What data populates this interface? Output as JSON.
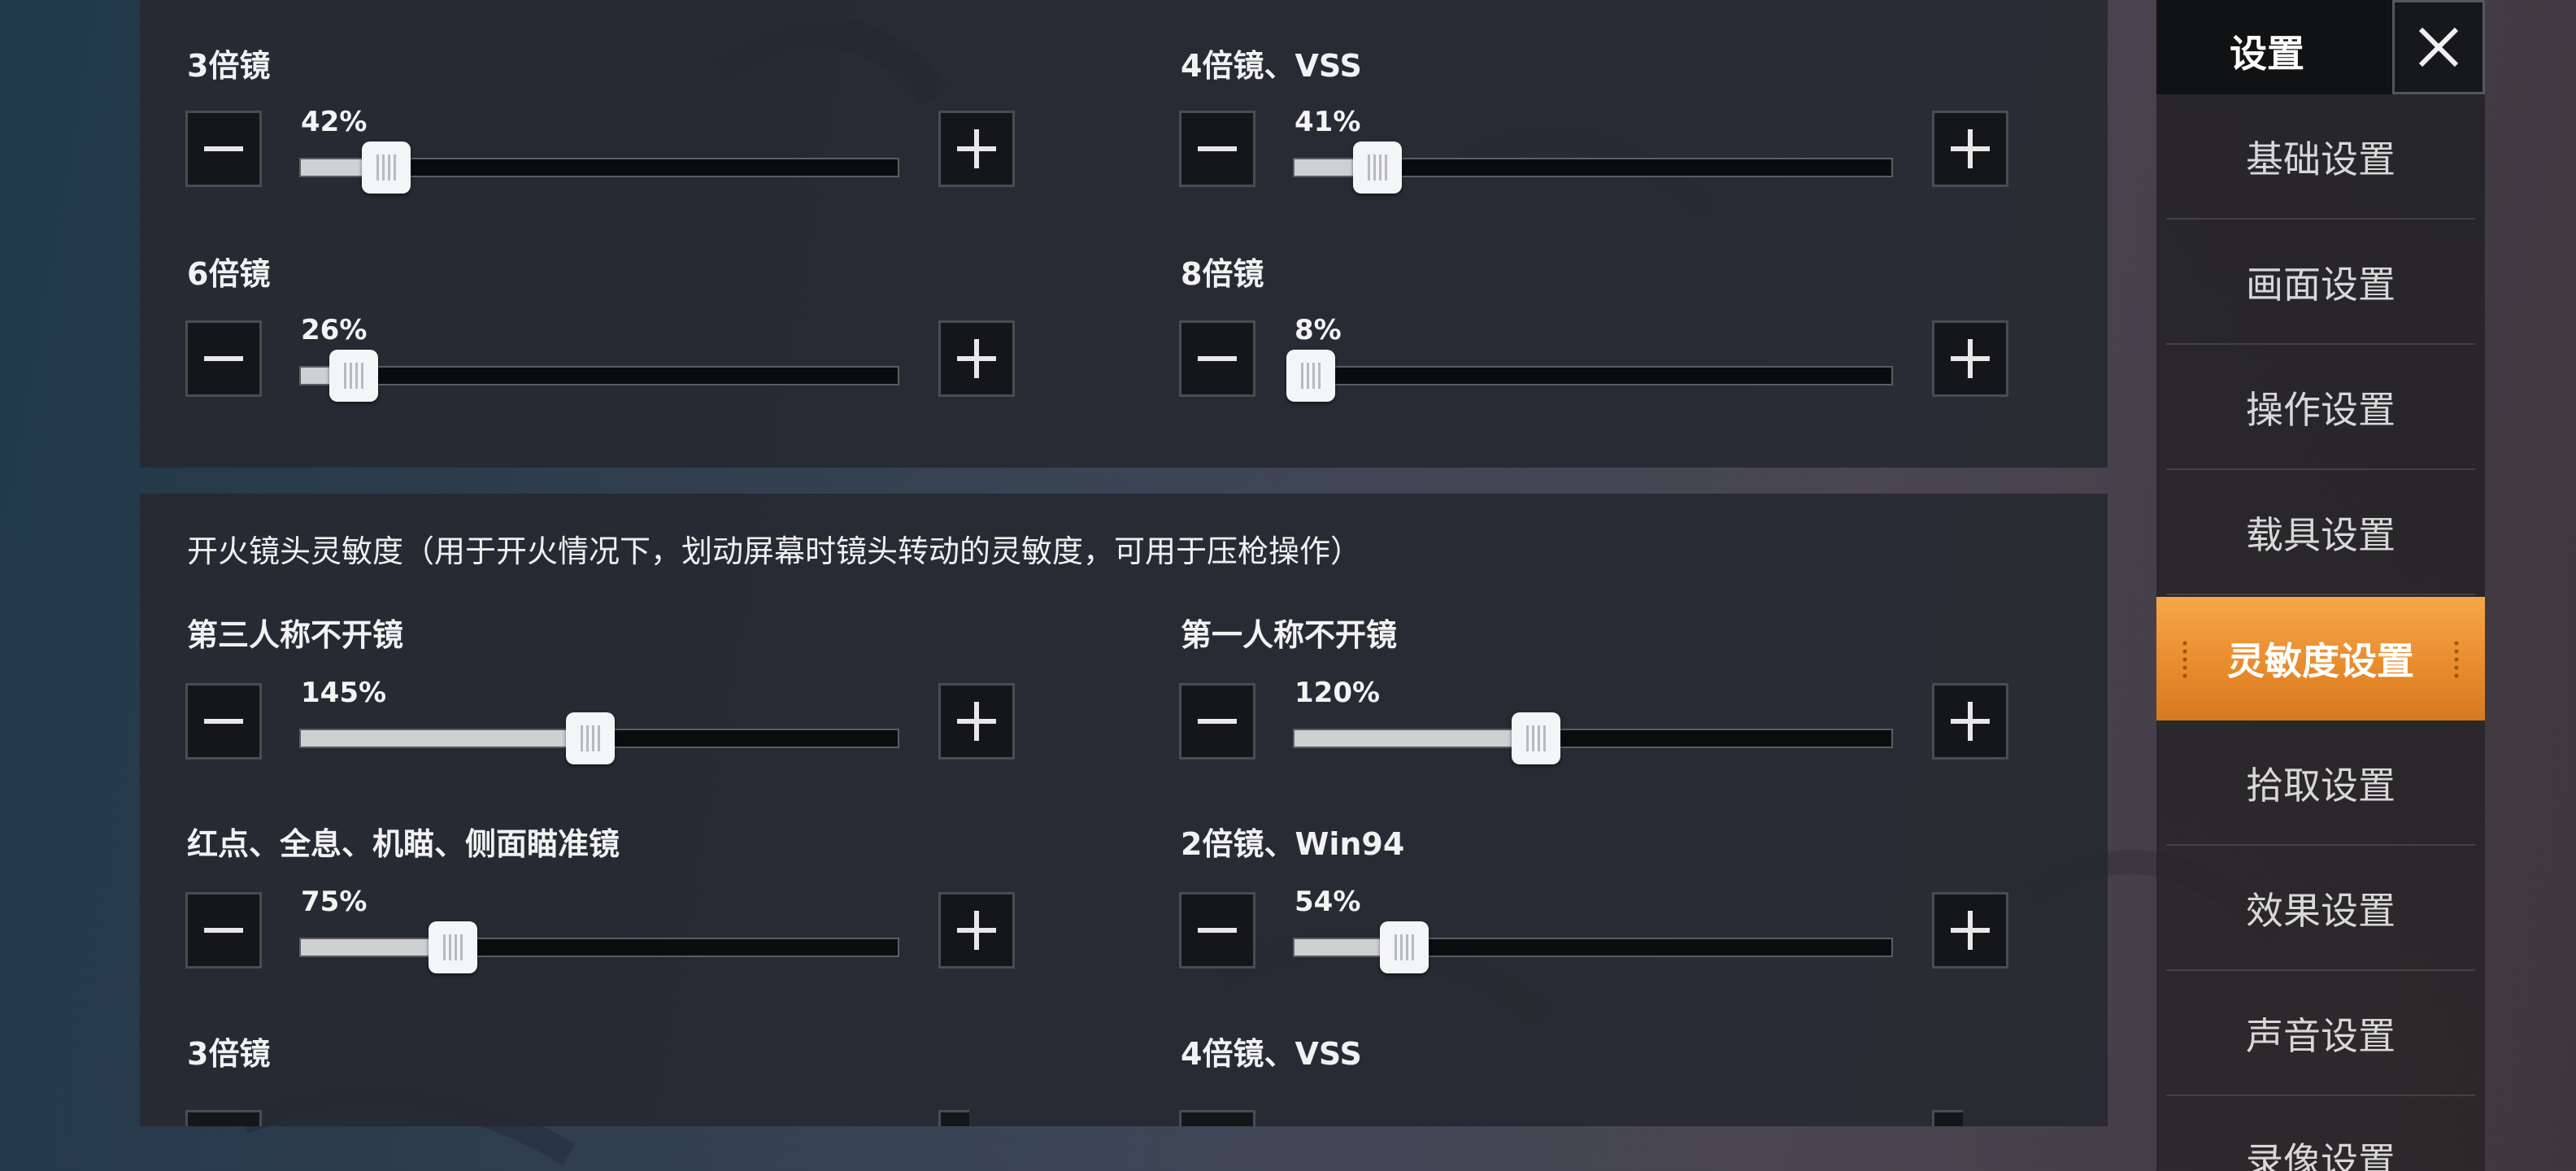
{
  "top_panel": {
    "sliders": [
      {
        "label": "3倍镜",
        "value_text": "42%",
        "fraction": 0.14
      },
      {
        "label": "4倍镜、VSS",
        "value_text": "41%",
        "fraction": 0.135
      },
      {
        "label": "6倍镜",
        "value_text": "26%",
        "fraction": 0.085
      },
      {
        "label": "8倍镜",
        "value_text": "8%",
        "fraction": 0.025
      }
    ]
  },
  "fire_section": {
    "title": "开火镜头灵敏度（用于开火情况下，划动屏幕时镜头转动的灵敏度，可用于压枪操作）",
    "sliders": [
      {
        "label": "第三人称不开镜",
        "value_text": "145%",
        "fraction": 0.48
      },
      {
        "label": "第一人称不开镜",
        "value_text": "120%",
        "fraction": 0.4
      },
      {
        "label": "红点、全息、机瞄、侧面瞄准镜",
        "value_text": "75%",
        "fraction": 0.25
      },
      {
        "label": "2倍镜、Win94",
        "value_text": "54%",
        "fraction": 0.18
      },
      {
        "label": "3倍镜",
        "value_text": "",
        "fraction": null
      },
      {
        "label": "4倍镜、VSS",
        "value_text": "",
        "fraction": null
      }
    ]
  },
  "sidebar": {
    "title": "设置",
    "items": [
      {
        "label": "基础设置"
      },
      {
        "label": "画面设置"
      },
      {
        "label": "操作设置"
      },
      {
        "label": "载具设置"
      },
      {
        "label": "灵敏度设置"
      },
      {
        "label": "拾取设置"
      },
      {
        "label": "效果设置"
      },
      {
        "label": "声音设置"
      },
      {
        "label": "录像设置"
      }
    ],
    "active_index": 4
  },
  "icons": {
    "minus": "minus-icon",
    "plus": "plus-icon",
    "close": "close-icon"
  },
  "colors": {
    "accent": "#f0952f",
    "slider_fill": "#cfd0d2"
  }
}
